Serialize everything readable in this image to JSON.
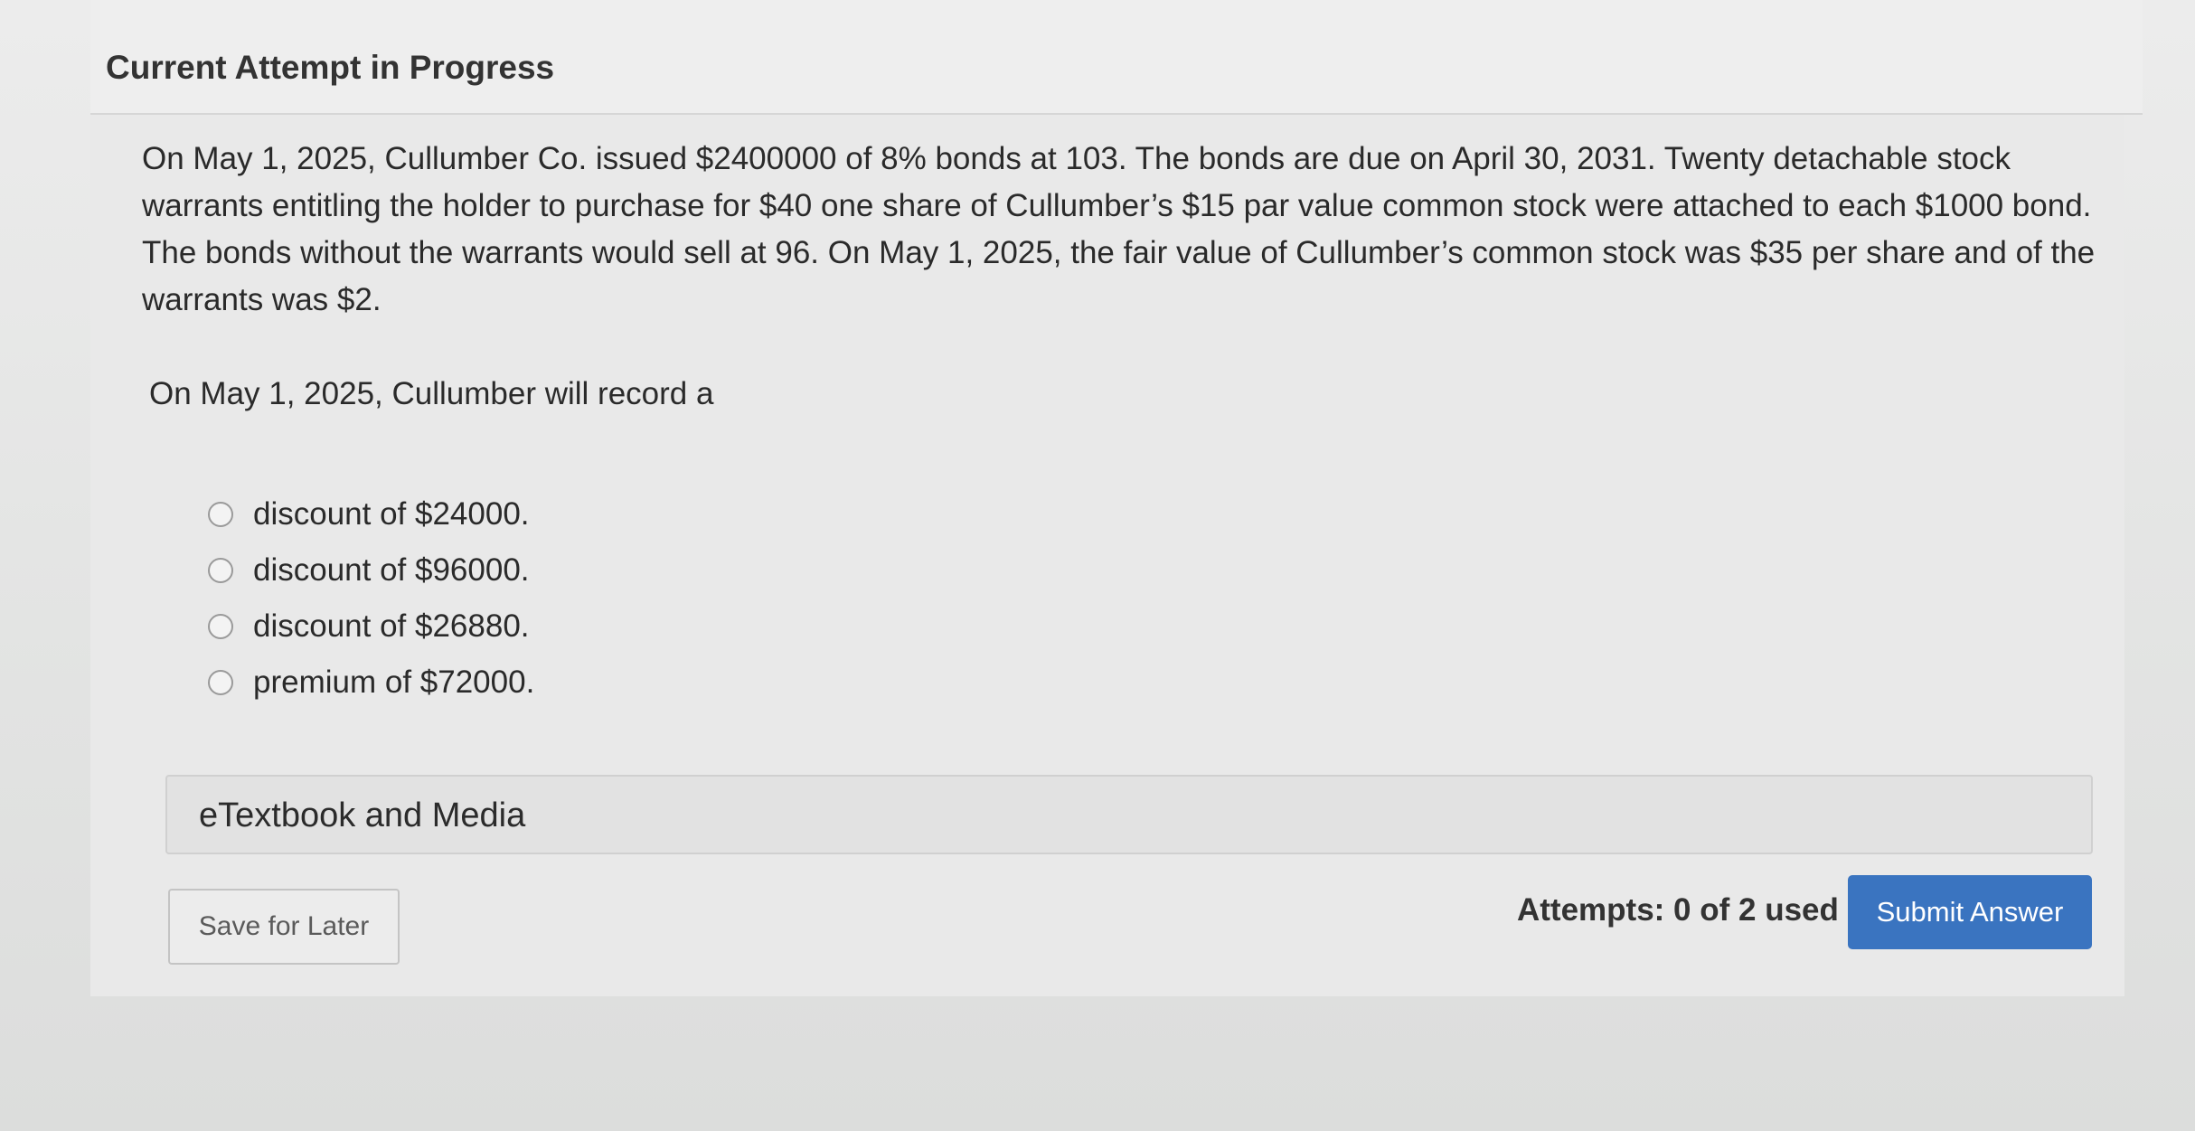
{
  "section": {
    "title": "Current Attempt in Progress"
  },
  "question": {
    "text": "On May 1, 2025, Cullumber Co. issued $2400000 of 8% bonds at 103. The bonds are due on April 30, 2031. Twenty detachable stock warrants entitling the holder to purchase for $40 one share of Cullumber’s $15 par value common stock were attached to each $1000 bond. The bonds without the warrants would sell at 96. On May 1, 2025, the fair value of Cullumber’s common stock was $35 per share and of the warrants was $2.",
    "prompt": "On May 1, 2025, Cullumber will record a",
    "options": [
      {
        "label": "discount of $24000."
      },
      {
        "label": "discount of $96000."
      },
      {
        "label": "discount of $26880."
      },
      {
        "label": "premium of $72000."
      }
    ]
  },
  "resources": {
    "label": "eTextbook and Media"
  },
  "actions": {
    "save_label": "Save for Later",
    "attempts_text": "Attempts: 0 of 2 used",
    "submit_label": "Submit Answer"
  },
  "colors": {
    "submit_button": "#3a74c0",
    "background": "#e6e6e6"
  }
}
